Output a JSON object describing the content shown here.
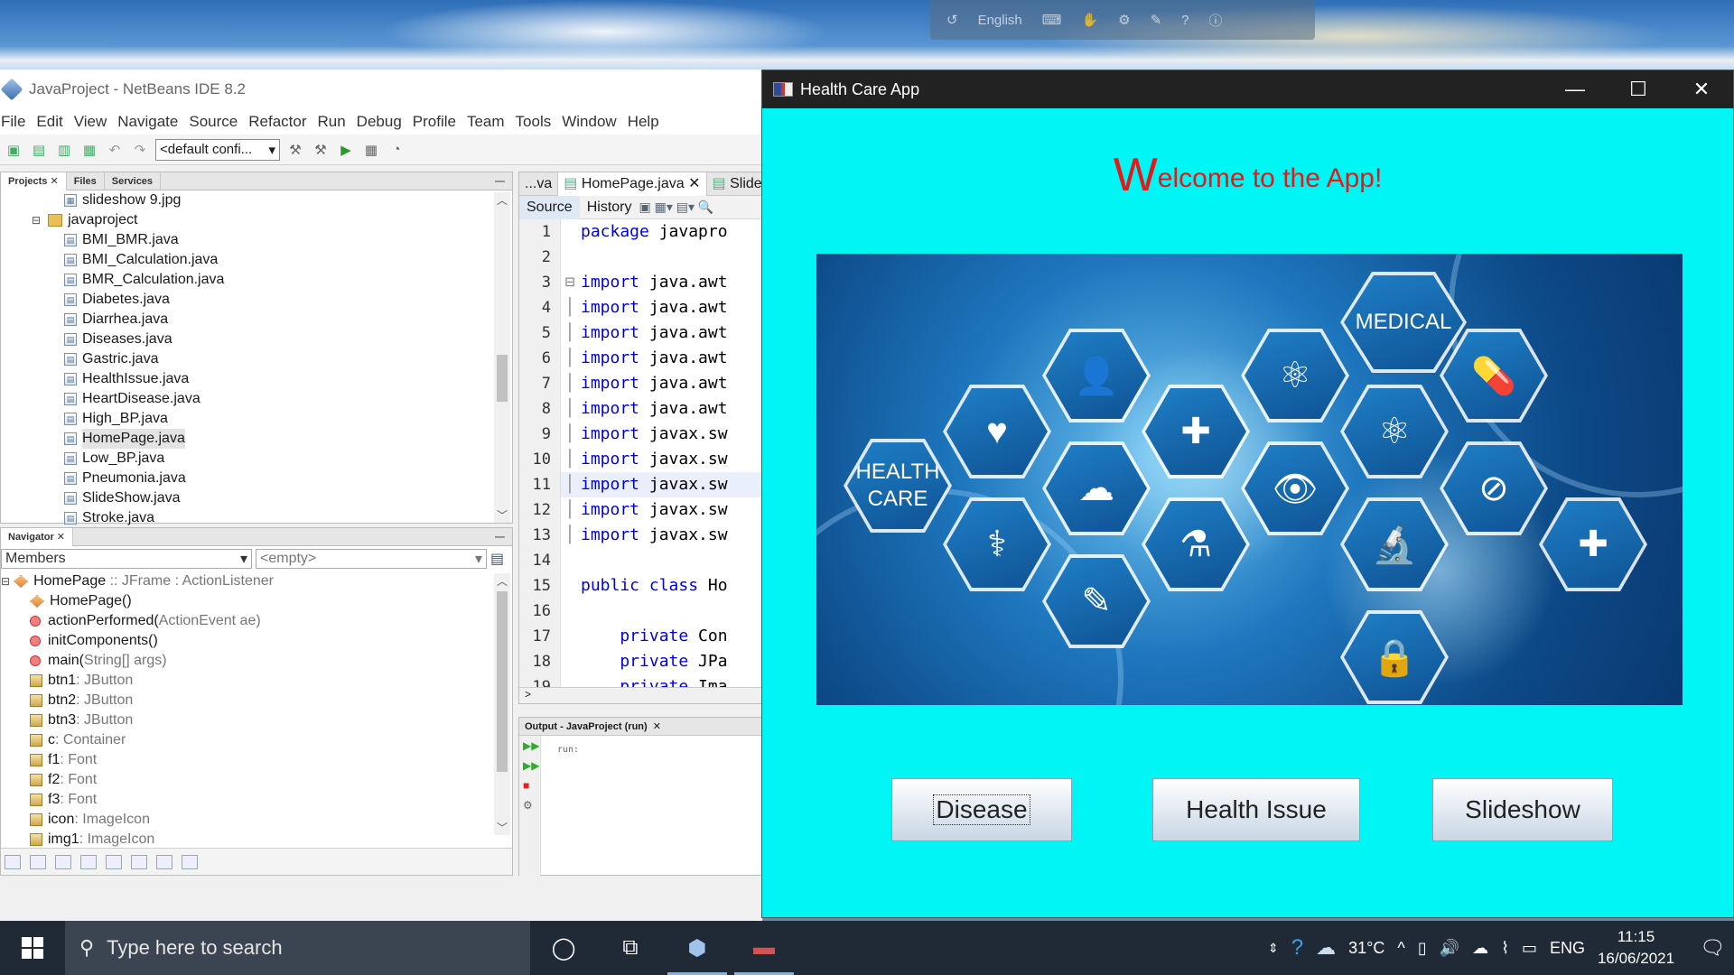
{
  "langbar": {
    "language": "English"
  },
  "netbeans": {
    "title": "JavaProject - NetBeans IDE 8.2",
    "menu": [
      "File",
      "Edit",
      "View",
      "Navigate",
      "Source",
      "Refactor",
      "Run",
      "Debug",
      "Profile",
      "Team",
      "Tools",
      "Window",
      "Help"
    ],
    "config": "<default confi...",
    "projects_tabs": [
      "Projects",
      "Files",
      "Services"
    ],
    "tree": {
      "top_file": "slideshow 9.jpg",
      "package": "javaproject",
      "files": [
        "BMI_BMR.java",
        "BMI_Calculation.java",
        "BMR_Calculation.java",
        "Diabetes.java",
        "Diarrhea.java",
        "Diseases.java",
        "Gastric.java",
        "HealthIssue.java",
        "HeartDisease.java",
        "High_BP.java",
        "HomePage.java",
        "Low_BP.java",
        "Pneumonia.java",
        "SlideShow.java",
        "Stroke.java"
      ],
      "selected": "HomePage.java"
    },
    "navigator": {
      "title": "Navigator",
      "members_select": "Members",
      "filter_select": "<empty>",
      "root": {
        "name": "HomePage",
        "type": ":: JFrame : ActionListener"
      },
      "items": [
        {
          "kind": "constructor",
          "name": "HomePage()",
          "type": ""
        },
        {
          "kind": "method",
          "name": "actionPerformed(",
          "type": "ActionEvent ae)"
        },
        {
          "kind": "method",
          "name": "initComponents()",
          "type": ""
        },
        {
          "kind": "method",
          "name": "main(",
          "type": "String[] args)"
        },
        {
          "kind": "field",
          "name": "btn1",
          "type": " : JButton"
        },
        {
          "kind": "field",
          "name": "btn2",
          "type": " : JButton"
        },
        {
          "kind": "field",
          "name": "btn3",
          "type": " : JButton"
        },
        {
          "kind": "field",
          "name": "c",
          "type": " : Container"
        },
        {
          "kind": "field",
          "name": "f1",
          "type": " : Font"
        },
        {
          "kind": "field",
          "name": "f2",
          "type": " : Font"
        },
        {
          "kind": "field",
          "name": "f3",
          "type": " : Font"
        },
        {
          "kind": "field",
          "name": "icon",
          "type": " : ImageIcon"
        },
        {
          "kind": "field",
          "name": "img1",
          "type": " : ImageIcon"
        }
      ]
    },
    "editor": {
      "tabs": [
        "...va",
        "HomePage.java",
        "SlideS"
      ],
      "subtabs": [
        "Source",
        "History"
      ],
      "lines": [
        {
          "n": "1",
          "kw": "package",
          "rest": " javapro"
        },
        {
          "n": "2",
          "kw": "",
          "rest": ""
        },
        {
          "n": "3",
          "kw": "import",
          "rest": " java.awt"
        },
        {
          "n": "4",
          "kw": "import",
          "rest": " java.awt"
        },
        {
          "n": "5",
          "kw": "import",
          "rest": " java.awt"
        },
        {
          "n": "6",
          "kw": "import",
          "rest": " java.awt"
        },
        {
          "n": "7",
          "kw": "import",
          "rest": " java.awt"
        },
        {
          "n": "8",
          "kw": "import",
          "rest": " java.awt"
        },
        {
          "n": "9",
          "kw": "import",
          "rest": " javax.sw"
        },
        {
          "n": "10",
          "kw": "import",
          "rest": " javax.sw"
        },
        {
          "n": "11",
          "kw": "import",
          "rest": " javax.sw"
        },
        {
          "n": "12",
          "kw": "import",
          "rest": " javax.sw"
        },
        {
          "n": "13",
          "kw": "import",
          "rest": " javax.sw"
        },
        {
          "n": "14",
          "kw": "",
          "rest": ""
        },
        {
          "n": "15",
          "kw": "public class",
          "rest": " Ho"
        },
        {
          "n": "16",
          "kw": "",
          "rest": ""
        },
        {
          "n": "17",
          "kw": "    private",
          "rest": " Con"
        },
        {
          "n": "18",
          "kw": "    private",
          "rest": " JPa"
        },
        {
          "n": "19",
          "kw": "    private",
          "rest": " Ima"
        }
      ]
    },
    "output": {
      "tab": "Output - JavaProject (run)",
      "text": "run:"
    }
  },
  "health_app": {
    "window_title": "Health Care App",
    "welcome_first": "W",
    "welcome_rest": "elcome to the App!",
    "banner_labels": {
      "medical": "MEDICAL",
      "health": "HEALTH",
      "care": "CARE"
    },
    "buttons": [
      "Disease",
      "Health Issue",
      "Slideshow"
    ],
    "colors": {
      "background": "#00f5f5",
      "welcome": "#e31a1a"
    }
  },
  "taskbar": {
    "search_placeholder": "Type here to search",
    "weather": "31°C",
    "lang": "ENG",
    "time": "11:15",
    "date": "16/06/2021"
  }
}
